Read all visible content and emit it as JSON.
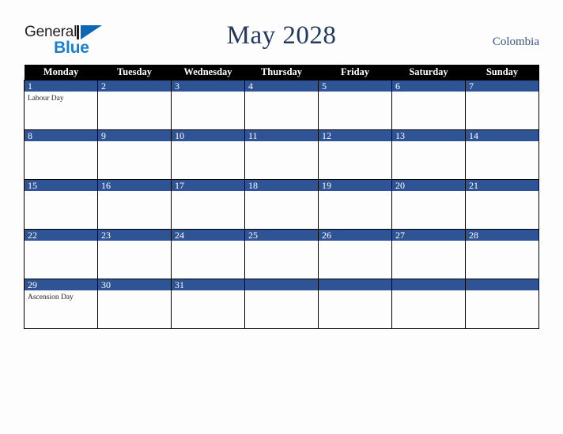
{
  "logo": {
    "word_one": "General",
    "word_two": "Blue",
    "mark": "blue-triangle-icon"
  },
  "header": {
    "title": "May 2028",
    "country": "Colombia"
  },
  "colors": {
    "day_band": "#2f5496",
    "header_bar": "#000000",
    "title": "#23395d",
    "country": "#3c5580",
    "logo_blue": "#1b7fd0",
    "page_background": "#fdfdfd"
  },
  "calendar": {
    "weekday_headers": [
      "Monday",
      "Tuesday",
      "Wednesday",
      "Thursday",
      "Friday",
      "Saturday",
      "Sunday"
    ],
    "weeks": [
      [
        {
          "day": "1",
          "events": [
            "Labour Day"
          ]
        },
        {
          "day": "2",
          "events": []
        },
        {
          "day": "3",
          "events": []
        },
        {
          "day": "4",
          "events": []
        },
        {
          "day": "5",
          "events": []
        },
        {
          "day": "6",
          "events": []
        },
        {
          "day": "7",
          "events": []
        }
      ],
      [
        {
          "day": "8",
          "events": []
        },
        {
          "day": "9",
          "events": []
        },
        {
          "day": "10",
          "events": []
        },
        {
          "day": "11",
          "events": []
        },
        {
          "day": "12",
          "events": []
        },
        {
          "day": "13",
          "events": []
        },
        {
          "day": "14",
          "events": []
        }
      ],
      [
        {
          "day": "15",
          "events": []
        },
        {
          "day": "16",
          "events": []
        },
        {
          "day": "17",
          "events": []
        },
        {
          "day": "18",
          "events": []
        },
        {
          "day": "19",
          "events": []
        },
        {
          "day": "20",
          "events": []
        },
        {
          "day": "21",
          "events": []
        }
      ],
      [
        {
          "day": "22",
          "events": []
        },
        {
          "day": "23",
          "events": []
        },
        {
          "day": "24",
          "events": []
        },
        {
          "day": "25",
          "events": []
        },
        {
          "day": "26",
          "events": []
        },
        {
          "day": "27",
          "events": []
        },
        {
          "day": "28",
          "events": []
        }
      ],
      [
        {
          "day": "29",
          "events": [
            "Ascension Day"
          ]
        },
        {
          "day": "30",
          "events": []
        },
        {
          "day": "31",
          "events": []
        },
        {
          "day": "",
          "events": []
        },
        {
          "day": "",
          "events": []
        },
        {
          "day": "",
          "events": []
        },
        {
          "day": "",
          "events": []
        }
      ]
    ]
  }
}
